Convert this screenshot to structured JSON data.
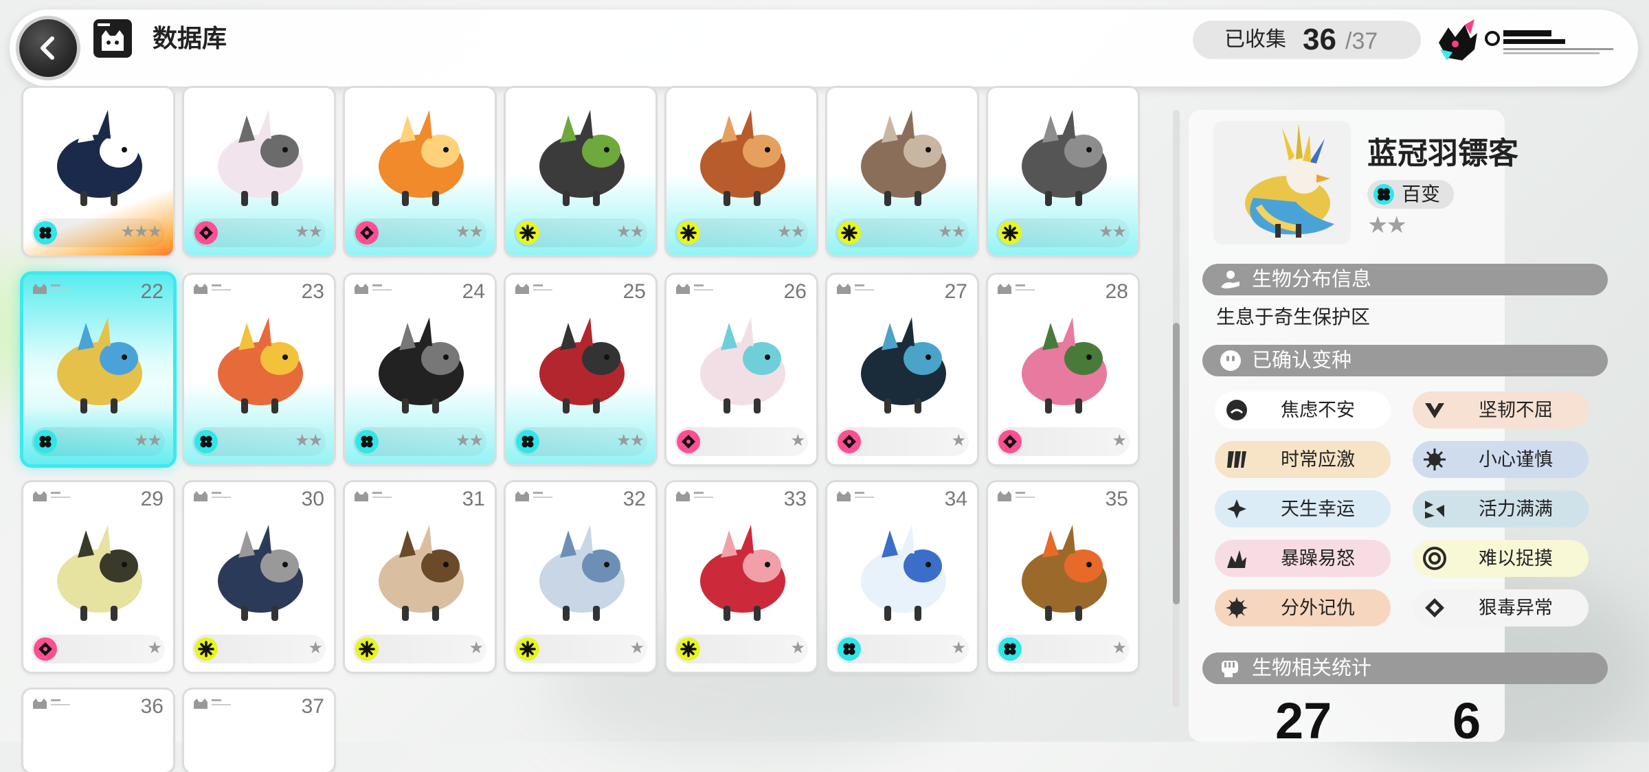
{
  "header": {
    "title": "数据库",
    "collect_label": "已收集",
    "collect_count": "36",
    "collect_total": "/37"
  },
  "grid": {
    "row1": [
      {
        "type": "cyan",
        "stars": "★★★",
        "glow": "orange"
      },
      {
        "type": "pink",
        "stars": "★★",
        "glow": "cyan"
      },
      {
        "type": "pink",
        "stars": "★★",
        "glow": "cyan"
      },
      {
        "type": "yellow",
        "stars": "★★",
        "glow": "cyan"
      },
      {
        "type": "yellow",
        "stars": "★★",
        "glow": "cyan"
      },
      {
        "type": "yellow",
        "stars": "★★",
        "glow": "cyan"
      },
      {
        "type": "yellow",
        "stars": "★★",
        "glow": "cyan"
      }
    ],
    "row2": [
      {
        "num": "22",
        "type": "cyan",
        "stars": "★★",
        "selected": true
      },
      {
        "num": "23",
        "type": "cyan",
        "stars": "★★"
      },
      {
        "num": "24",
        "type": "cyan",
        "stars": "★★"
      },
      {
        "num": "25",
        "type": "cyan",
        "stars": "★★"
      },
      {
        "num": "26",
        "type": "pink",
        "stars": "★"
      },
      {
        "num": "27",
        "type": "pink",
        "stars": "★"
      },
      {
        "num": "28",
        "type": "pink",
        "stars": "★"
      }
    ],
    "row3": [
      {
        "num": "29",
        "type": "pink",
        "stars": "★"
      },
      {
        "num": "30",
        "type": "yellow",
        "stars": "★"
      },
      {
        "num": "31",
        "type": "yellow",
        "stars": "★"
      },
      {
        "num": "32",
        "type": "yellow",
        "stars": "★"
      },
      {
        "num": "33",
        "type": "yellow",
        "stars": "★"
      },
      {
        "num": "34",
        "type": "cyan",
        "stars": "★"
      },
      {
        "num": "35",
        "type": "cyan",
        "stars": "★"
      }
    ],
    "row4": [
      {
        "num": "36"
      },
      {
        "num": "37"
      }
    ]
  },
  "colors": {
    "cyan": "#2fe6e8",
    "pink": "#ff4f93",
    "yellow": "#e8f51e",
    "selected_glow": "#3ce9ec"
  },
  "detail": {
    "name": "蓝冠羽镖客",
    "variant": "百变",
    "stars": "★★",
    "habitat_title": "生物分布信息",
    "habitat_text": "生息于奇生保护区",
    "variants_title": "已确认变种",
    "traits": [
      {
        "label": "焦虑不安",
        "color": "#ffffff"
      },
      {
        "label": "坚韧不屈",
        "color": "#f6e1d3"
      },
      {
        "label": "时常应激",
        "color": "#f7e3c6"
      },
      {
        "label": "小心谨慎",
        "color": "#cfdcee"
      },
      {
        "label": "天生幸运",
        "color": "#dcecf7"
      },
      {
        "label": "活力满满",
        "color": "#cfe2ea"
      },
      {
        "label": "暴躁易怒",
        "color": "#f7dce3"
      },
      {
        "label": "难以捉摸",
        "color": "#f8f8d6"
      },
      {
        "label": "分外记仇",
        "color": "#f7d6bf"
      },
      {
        "label": "狠毒异常",
        "color": "#f4f4f4"
      }
    ],
    "stats_title": "生物相关统计",
    "stat1": "27",
    "stat2": "6"
  }
}
